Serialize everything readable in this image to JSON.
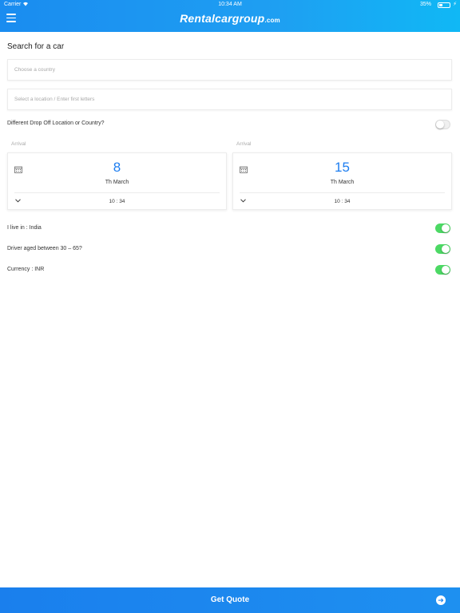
{
  "status_bar": {
    "carrier": "Carrier",
    "time": "10:34 AM",
    "battery_percent": "35%",
    "battery_level": 0.35
  },
  "header": {
    "logo_main": "Rentalcargroup",
    "logo_suffix": ".com",
    "menu_icon": "hamburger-icon"
  },
  "search": {
    "title": "Search for a car",
    "country_placeholder": "Choose a country",
    "location_placeholder": "Select a location / Enter first letters"
  },
  "drop_off": {
    "label": "Different Drop Off Location or Country?",
    "enabled": false
  },
  "pickup": {
    "label": "Arrival",
    "day": "8",
    "month": "Th March",
    "time": "10 : 34"
  },
  "dropoff_date": {
    "label": "Arrival",
    "day": "15",
    "month": "Th March",
    "time": "10 : 34"
  },
  "options": [
    {
      "label": "I live in : India",
      "enabled": true
    },
    {
      "label": "Driver aged between 30 – 65?",
      "enabled": true
    },
    {
      "label": "Currency : INR",
      "enabled": true
    }
  ],
  "footer": {
    "button_label": "Get Quote",
    "arrow_icon": "arrow-right-icon"
  },
  "colors": {
    "accent": "#1e85ef",
    "toggle_on": "#4cd964",
    "date_number": "#1e7ef0"
  }
}
